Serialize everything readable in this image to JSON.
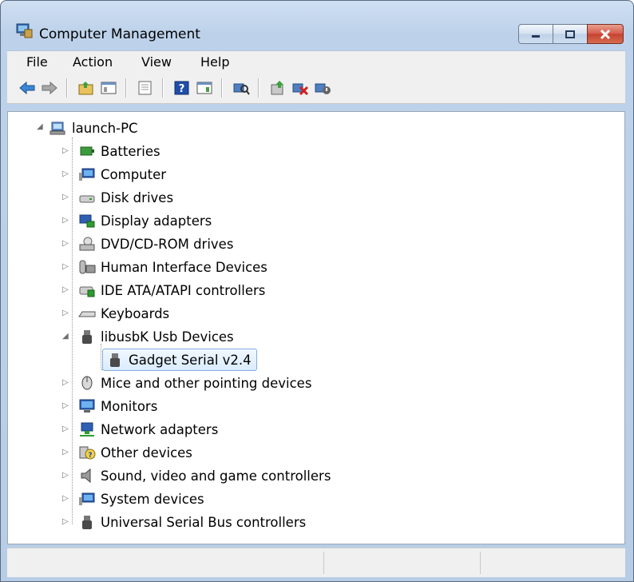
{
  "window": {
    "title": "Computer Management"
  },
  "menu": [
    "File",
    "Action",
    "View",
    "Help"
  ],
  "toolbar": {
    "buttons": [
      "back-arrow-icon",
      "forward-arrow-icon",
      "up-folder-icon",
      "show-hide-tree-icon",
      "properties-icon",
      "help-icon",
      "show-hide-action-pane-icon",
      "scan-hardware-icon",
      "update-driver-icon",
      "uninstall-icon",
      "enable-device-icon"
    ]
  },
  "tree": {
    "root": "launch-PC",
    "categories": [
      "Batteries",
      "Computer",
      "Disk drives",
      "Display adapters",
      "DVD/CD-ROM drives",
      "Human Interface Devices",
      "IDE ATA/ATAPI controllers",
      "Keyboards",
      "libusbK Usb Devices",
      "Mice and other pointing devices",
      "Monitors",
      "Network adapters",
      "Other devices",
      "Sound, video and game controllers",
      "System devices",
      "Universal Serial Bus controllers"
    ],
    "expanded_category_child": "Gadget Serial v2.4"
  },
  "colors": {
    "accent": "#3b79c6",
    "close_button": "#c5422f",
    "selection_border": "#84acdd"
  }
}
